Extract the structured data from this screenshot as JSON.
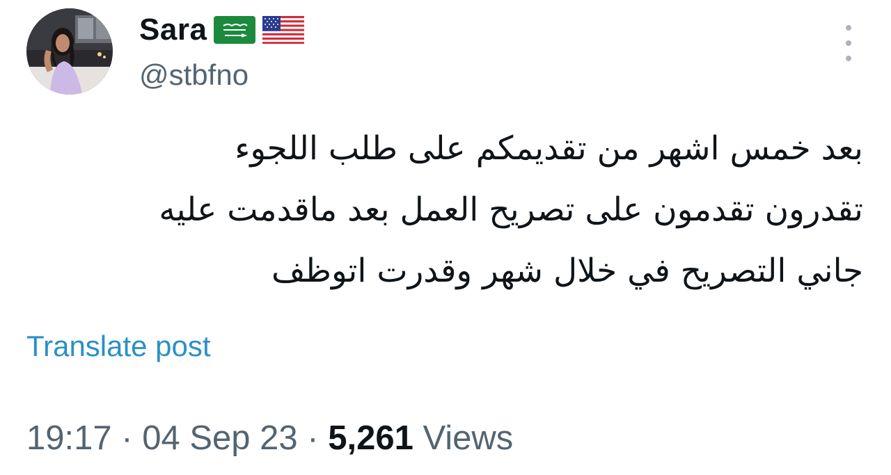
{
  "author": {
    "display_name": "Sara",
    "handle": "@stbfno",
    "flags": [
      "saudi-arabia-flag",
      "usa-flag"
    ]
  },
  "tweet": {
    "lines": [
      "بعد خمس اشهر من تقديمكم على طلب اللجوء",
      "تقدرون تقدمون على تصريح العمل بعد ماقدمت عليه",
      "جاني التصريح في خلال شهر وقدرت اتوظف"
    ],
    "translate_label": "Translate post"
  },
  "meta": {
    "time": "19:17",
    "separator": "·",
    "date": "04 Sep 23",
    "views_count": "5,261",
    "views_label": "Views"
  },
  "colors": {
    "text": "#0f1419",
    "secondary": "#536471",
    "link": "#2b8fc8"
  },
  "icons": {
    "more": "more-vertical-icon"
  }
}
